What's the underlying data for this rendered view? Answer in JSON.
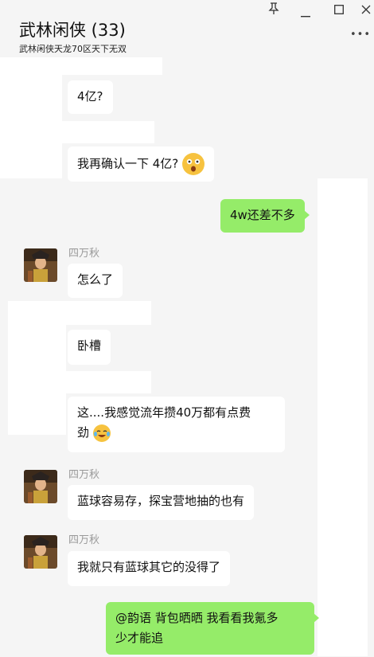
{
  "header": {
    "title": "武林闲侠 (33)",
    "subtitle": "武林闲侠天龙70区天下无双",
    "pin_icon": "pin-icon",
    "min_icon": "minimize-icon",
    "max_icon": "maximize-icon",
    "close_icon": "close-icon",
    "more_icon": "more-icon"
  },
  "messages": [
    {
      "text": "4亿?"
    },
    {
      "text": "我再确认一下 4亿?",
      "emoji": "astonished-face-emoji"
    },
    {
      "text": "4w还差不多",
      "mine": true
    },
    {
      "sender": "四万秋",
      "text": "怎么了"
    },
    {
      "text": "卧槽"
    },
    {
      "line1": "这....我感觉流年攒40万都有点费",
      "line2": "劲",
      "emoji": "tears-of-joy-emoji"
    },
    {
      "sender": "四万秋",
      "text": "蓝球容易存，探宝营地抽的也有"
    },
    {
      "sender": "四万秋",
      "text": "我就只有蓝球其它的没得了"
    },
    {
      "line1": "@韵语 背包晒晒 我看看我氪多",
      "line2": "少才能追",
      "mine": true
    }
  ],
  "colors": {
    "background": "#f5f5f5",
    "bubble_other": "#ffffff",
    "bubble_mine": "#95ec69"
  }
}
